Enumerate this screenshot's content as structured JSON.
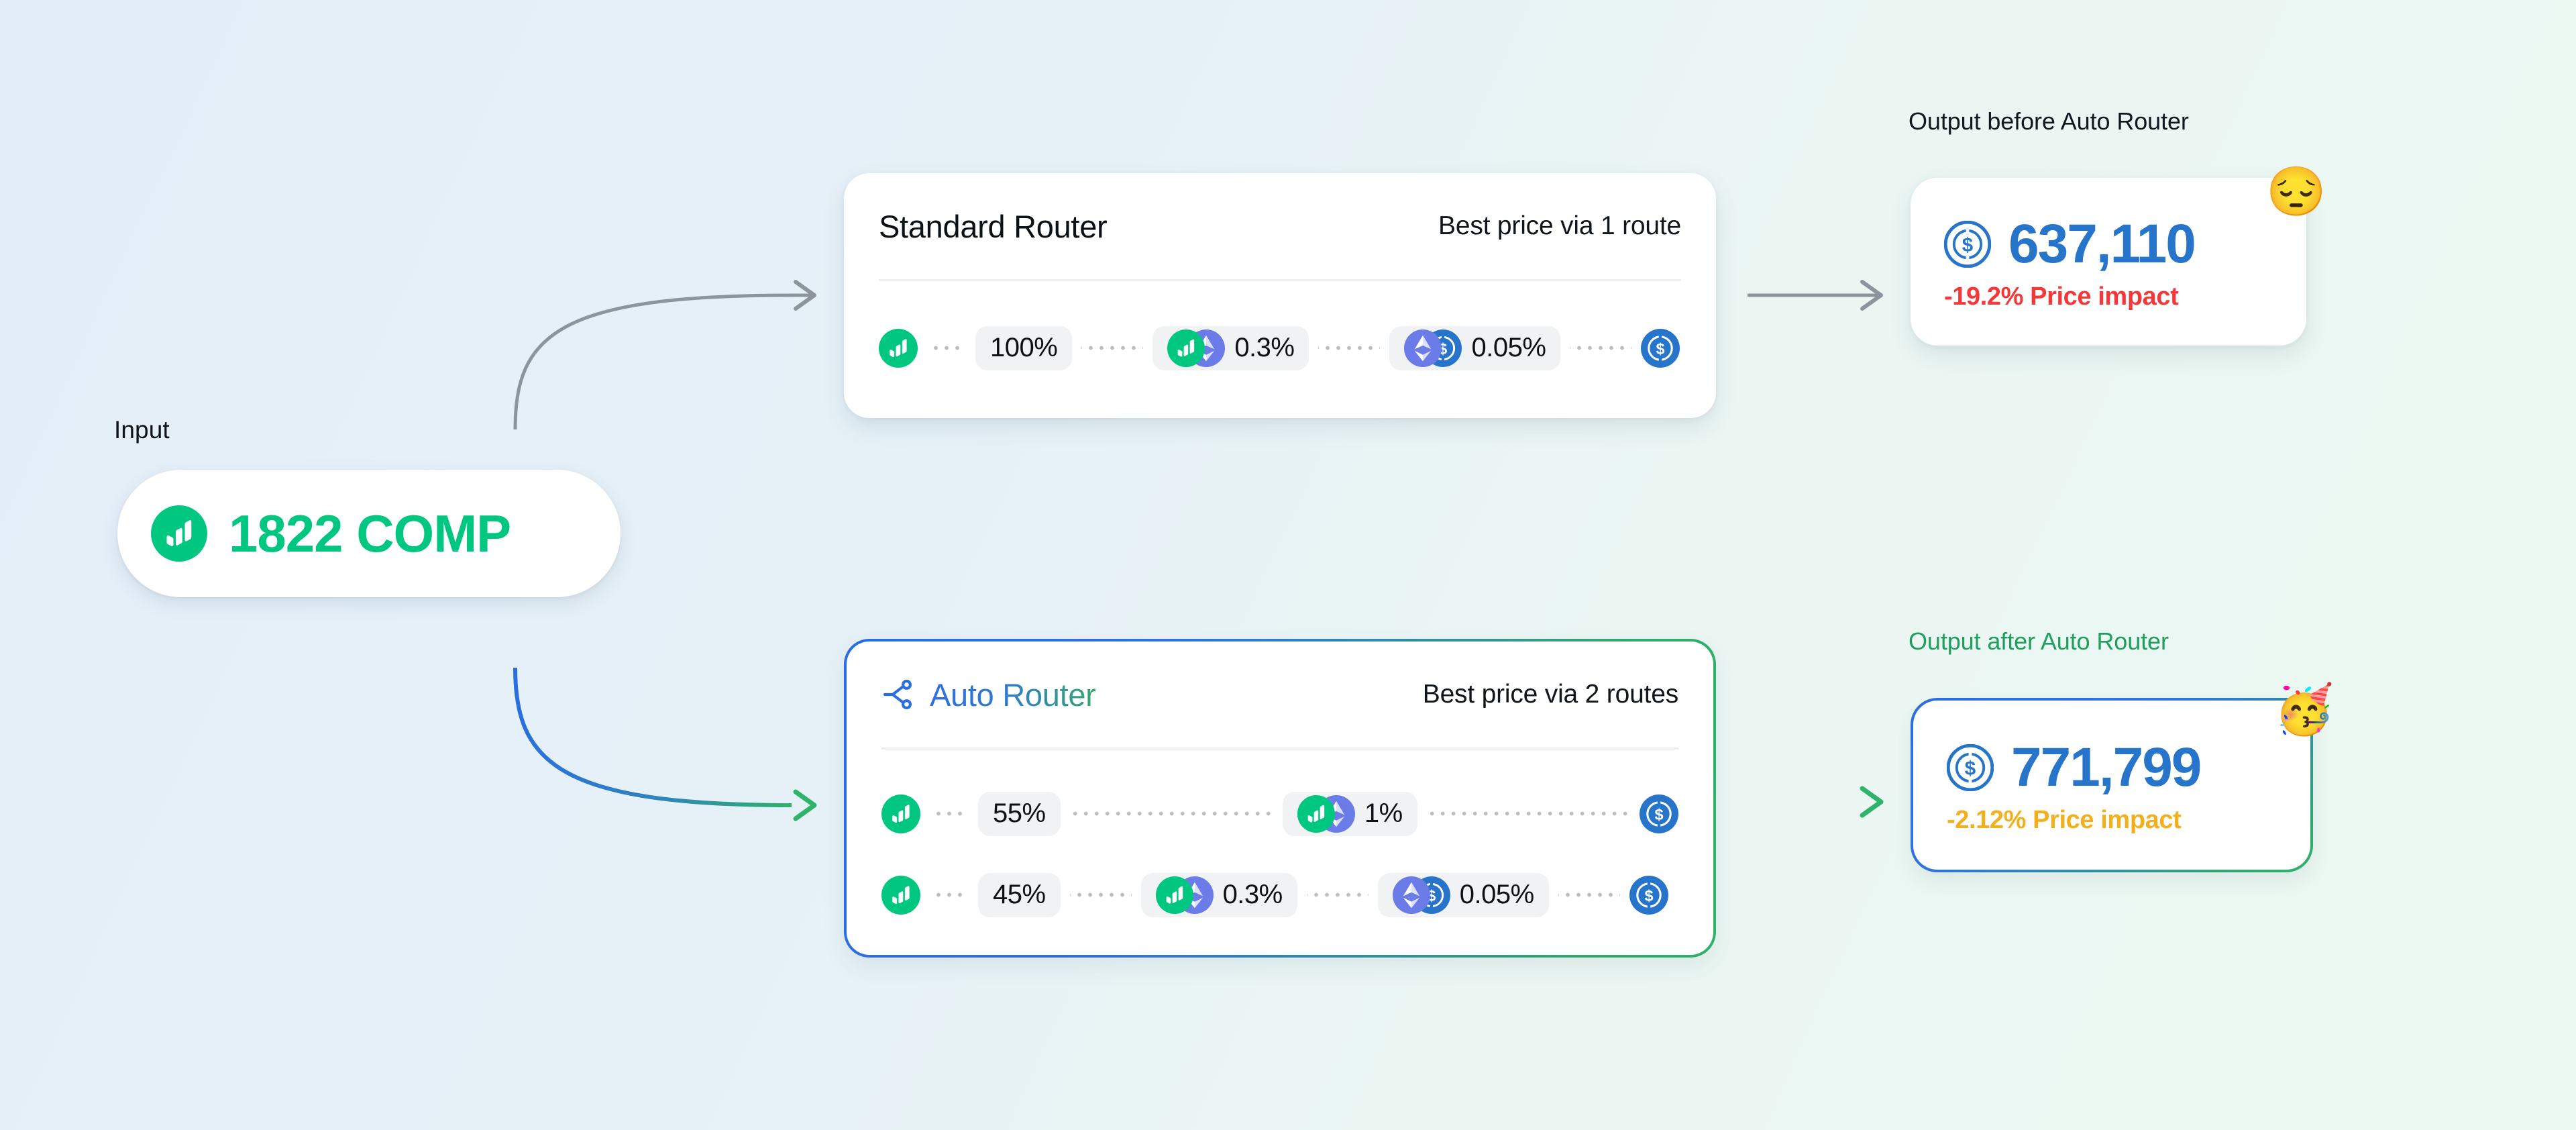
{
  "theme": {
    "bg_start": "#e4eef9",
    "bg_end": "#ebf8f0",
    "comp_green": "#00c780",
    "usdc_blue": "#2775ca",
    "eth_violet": "#6b7ce8",
    "accent_blue": "#2a6ee0",
    "accent_green": "#2eb36a",
    "impact_red": "#f4383a",
    "impact_amber": "#f2b01e"
  },
  "input": {
    "label": "Input",
    "amount": "1822 COMP",
    "token_icon": "comp-token-icon"
  },
  "standard_router": {
    "title": "Standard Router",
    "subtitle": "Best price via 1 route",
    "routes": [
      {
        "share": "100%",
        "hops": [
          {
            "fee": "0.3%",
            "pair": [
              "comp-token-icon",
              "eth-token-icon"
            ]
          },
          {
            "fee": "0.05%",
            "pair": [
              "eth-token-icon",
              "usdc-token-icon"
            ]
          }
        ],
        "start_icon": "comp-token-icon",
        "end_icon": "usdc-token-icon"
      }
    ]
  },
  "auto_router": {
    "title": "Auto Router",
    "title_icon": "route-split-icon",
    "subtitle": "Best price via 2 routes",
    "routes": [
      {
        "share": "55%",
        "hops": [
          {
            "fee": "1%",
            "pair": [
              "comp-token-icon",
              "eth-token-icon"
            ]
          }
        ],
        "start_icon": "comp-token-icon",
        "end_icon": "usdc-token-icon"
      },
      {
        "share": "45%",
        "hops": [
          {
            "fee": "0.3%",
            "pair": [
              "comp-token-icon",
              "eth-token-icon"
            ]
          },
          {
            "fee": "0.05%",
            "pair": [
              "eth-token-icon",
              "usdc-token-icon"
            ]
          }
        ],
        "start_icon": "comp-token-icon",
        "end_icon": "usdc-token-icon"
      }
    ]
  },
  "output_before": {
    "label": "Output before Auto Router",
    "value": "637,110",
    "token_icon": "usdc-token-icon",
    "price_impact": "-19.2% Price impact",
    "emoji": "😔",
    "emoji_name": "pensive-face-emoji"
  },
  "output_after": {
    "label": "Output after Auto Router",
    "value": "771,799",
    "token_icon": "usdc-token-icon",
    "price_impact": "-2.12% Price impact",
    "emoji": "🥳",
    "emoji_name": "partying-face-emoji"
  }
}
